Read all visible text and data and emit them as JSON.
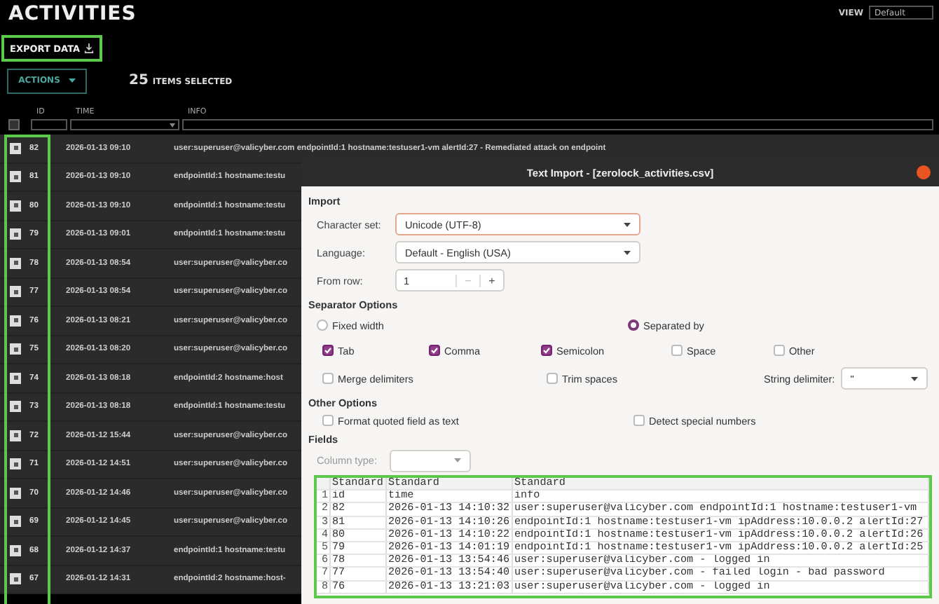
{
  "page": {
    "title": "ACTIVITIES",
    "view_label": "VIEW",
    "view_value": "Default"
  },
  "export_button": "EXPORT DATA",
  "actions_button": "ACTIONS",
  "selection": {
    "count": "25",
    "label": "ITEMS SELECTED"
  },
  "table": {
    "select_all": {
      "checked": false
    },
    "columns": [
      "ID",
      "TIME",
      "INFO"
    ],
    "rows": [
      {
        "checked": true,
        "id": "82",
        "time": "2026-01-13 09:10",
        "info": "user:superuser@valicyber.com endpointId:1 hostname:testuser1-vm alertId:27 - Remediated attack on endpoint"
      },
      {
        "checked": true,
        "id": "81",
        "time": "2026-01-13 09:10",
        "info": "endpointId:1 hostname:testu"
      },
      {
        "checked": true,
        "id": "80",
        "time": "2026-01-13 09:10",
        "info": "endpointId:1 hostname:testu"
      },
      {
        "checked": true,
        "id": "79",
        "time": "2026-01-13 09:01",
        "info": "endpointId:1 hostname:testu"
      },
      {
        "checked": true,
        "id": "78",
        "time": "2026-01-13 08:54",
        "info": "user:superuser@valicyber.co"
      },
      {
        "checked": true,
        "id": "77",
        "time": "2026-01-13 08:54",
        "info": "user:superuser@valicyber.co"
      },
      {
        "checked": true,
        "id": "76",
        "time": "2026-01-13 08:21",
        "info": "user:superuser@valicyber.co"
      },
      {
        "checked": true,
        "id": "75",
        "time": "2026-01-13 08:20",
        "info": "user:superuser@valicyber.co"
      },
      {
        "checked": true,
        "id": "74",
        "time": "2026-01-13 08:18",
        "info": "endpointId:2 hostname:host"
      },
      {
        "checked": true,
        "id": "73",
        "time": "2026-01-13 08:18",
        "info": "endpointId:1 hostname:testu"
      },
      {
        "checked": true,
        "id": "72",
        "time": "2026-01-12 15:44",
        "info": "user:superuser@valicyber.co"
      },
      {
        "checked": true,
        "id": "71",
        "time": "2026-01-12 14:51",
        "info": "user:superuser@valicyber.co"
      },
      {
        "checked": true,
        "id": "70",
        "time": "2026-01-12 14:46",
        "info": "user:superuser@valicyber.co"
      },
      {
        "checked": true,
        "id": "69",
        "time": "2026-01-12 14:45",
        "info": "user:superuser@valicyber.co"
      },
      {
        "checked": true,
        "id": "68",
        "time": "2026-01-12 14:37",
        "info": "endpointId:1 hostname:testu"
      },
      {
        "checked": true,
        "id": "67",
        "time": "2026-01-12 14:31",
        "info": "endpointId:2 hostname:host-"
      }
    ]
  },
  "dialog": {
    "title": "Text Import - [zerolock_activities.csv]",
    "import": {
      "heading": "Import",
      "charset_label": "Character set:",
      "charset": "Unicode (UTF-8)",
      "language_label": "Language:",
      "language": "Default - English (USA)",
      "from_row_label": "From row:",
      "from_row": "1",
      "minus": "−",
      "plus": "+"
    },
    "separator": {
      "heading": "Separator Options",
      "modes": [
        {
          "label": "Fixed width",
          "selected": false
        },
        {
          "label": "Separated by",
          "selected": true
        }
      ],
      "options": [
        {
          "label": "Tab",
          "checked": true
        },
        {
          "label": "Comma",
          "checked": true
        },
        {
          "label": "Semicolon",
          "checked": true
        },
        {
          "label": "Space",
          "checked": false
        },
        {
          "label": "Other",
          "checked": false
        }
      ],
      "merge": {
        "label": "Merge delimiters",
        "checked": false
      },
      "trim": {
        "label": "Trim spaces",
        "checked": false
      },
      "string_delimiter_label": "String delimiter:",
      "string_delimiter": "\""
    },
    "other": {
      "heading": "Other Options",
      "options": [
        {
          "label": "Format quoted field as text",
          "checked": false
        },
        {
          "label": "Detect special numbers",
          "checked": false
        }
      ]
    },
    "fields": {
      "heading": "Fields",
      "column_type_label": "Column type:",
      "preview_header": [
        "Standard",
        "Standard",
        "Standard"
      ],
      "preview_rows": [
        [
          "1",
          "id",
          "time",
          "info"
        ],
        [
          "2",
          "82",
          "2026-01-13 14:10:32",
          "user:superuser@valicyber.com endpointId:1 hostname:testuser1-vm"
        ],
        [
          "3",
          "81",
          "2026-01-13 14:10:26",
          "endpointId:1 hostname:testuser1-vm ipAddress:10.0.0.2 alertId:27"
        ],
        [
          "4",
          "80",
          "2026-01-13 14:10:22",
          "endpointId:1 hostname:testuser1-vm ipAddress:10.0.0.2 alertId:26"
        ],
        [
          "5",
          "79",
          "2026-01-13 14:01:19",
          "endpointId:1 hostname:testuser1-vm ipAddress:10.0.0.2 alertId:25"
        ],
        [
          "6",
          "78",
          "2026-01-13 13:54:46",
          "user:superuser@valicyber.com  - logged in"
        ],
        [
          "7",
          "77",
          "2026-01-13 13:54:40",
          "user:superuser@valicyber.com  - failed login - bad password"
        ],
        [
          "8",
          "76",
          "2026-01-13 13:21:03",
          "user:superuser@valicyber.com  - logged in"
        ]
      ]
    }
  }
}
